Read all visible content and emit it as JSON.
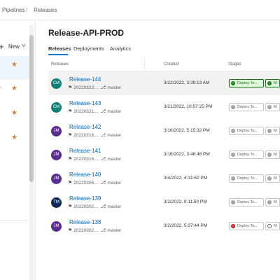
{
  "breadcrumb": {
    "pipelines": "Pipelines",
    "separator": "/",
    "releases": "Releases"
  },
  "left_pane": {
    "new_label": "New"
  },
  "page": {
    "title": "Release-API-PROD"
  },
  "tabs": [
    "Releases",
    "Deployments",
    "Analytics"
  ],
  "columns": {
    "releases": "Releases",
    "created": "Created",
    "stages": "Stages"
  },
  "colors": {
    "accent": "#0078d4",
    "success": "#107c10",
    "failed": "#c50f1f",
    "star": "#d67f3c"
  },
  "releases": [
    {
      "name": "Release-144",
      "initials": "CM",
      "avatar_color": "#0e7f74",
      "build": "20220322....",
      "branch": "master",
      "created": "3/22/2022, 3:39:13 AM",
      "stages": [
        {
          "label": "Deploy To...",
          "status": "success"
        },
        {
          "label": "M",
          "status": "success"
        }
      ]
    },
    {
      "name": "Release-143",
      "initials": "CM",
      "avatar_color": "#0e7f74",
      "build": "20220321....",
      "branch": "master",
      "created": "3/21/2022, 10:57:25 PM",
      "stages": [
        {
          "label": "Deploy To...",
          "status": "notdeployed"
        },
        {
          "label": "M",
          "status": "notdeployed"
        }
      ]
    },
    {
      "name": "Release-142",
      "initials": "JM",
      "avatar_color": "#5c2d91",
      "build": "20220316....",
      "branch": "master",
      "created": "3/16/2022, 5:15:32 PM",
      "stages": [
        {
          "label": "Deploy To...",
          "status": "notdeployed"
        },
        {
          "label": "M",
          "status": "notdeployed"
        }
      ]
    },
    {
      "name": "Release-141",
      "initials": "JM",
      "avatar_color": "#5c2d91",
      "build": "20220316....",
      "branch": "master",
      "created": "3/16/2022, 3:46:48 PM",
      "stages": [
        {
          "label": "Deploy To...",
          "status": "notdeployed"
        },
        {
          "label": "M",
          "status": "notdeployed"
        }
      ]
    },
    {
      "name": "Release-140",
      "initials": "JM",
      "avatar_color": "#5c2d91",
      "build": "20220304....",
      "branch": "master",
      "created": "3/4/2022, 4:31:50 PM",
      "stages": [
        {
          "label": "Deploy To...",
          "status": "notdeployed"
        },
        {
          "label": "M",
          "status": "notdeployed"
        }
      ]
    },
    {
      "name": "Release-139",
      "initials": "TM",
      "avatar_color": "#0b2a5b",
      "build": "20220302....",
      "branch": "master",
      "created": "3/2/2022, 9:11:50 PM",
      "stages": [
        {
          "label": "Deploy To...",
          "status": "notdeployed"
        },
        {
          "label": "M",
          "status": "notdeployed"
        }
      ]
    },
    {
      "name": "Release-138",
      "initials": "JM",
      "avatar_color": "#5c2d91",
      "build": "20220302....",
      "branch": "master",
      "created": "3/2/2022, 5:37:44 PM",
      "stages": [
        {
          "label": "Deploy To...",
          "status": "failed"
        },
        {
          "label": "M",
          "status": "notstarted"
        }
      ]
    }
  ]
}
